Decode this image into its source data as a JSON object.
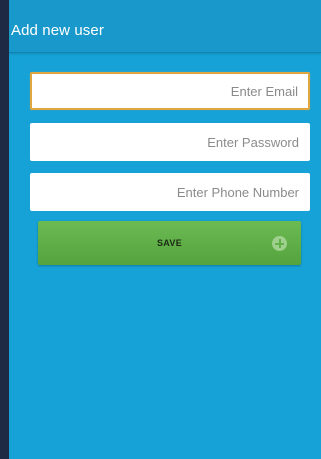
{
  "action_bar": {
    "title": "Add new user"
  },
  "form": {
    "email": {
      "value": "",
      "placeholder": "Enter Email"
    },
    "password": {
      "value": "",
      "placeholder": "Enter Password"
    },
    "phone": {
      "value": "",
      "placeholder": "Enter Phone Number"
    },
    "save_button": {
      "label": "SAVE",
      "icon": "plus-circle-icon"
    }
  },
  "colors": {
    "background": "#16a2d6",
    "action_bar": "#1898cb",
    "focus_border": "#e0a640",
    "save_button": "#5eae47"
  }
}
